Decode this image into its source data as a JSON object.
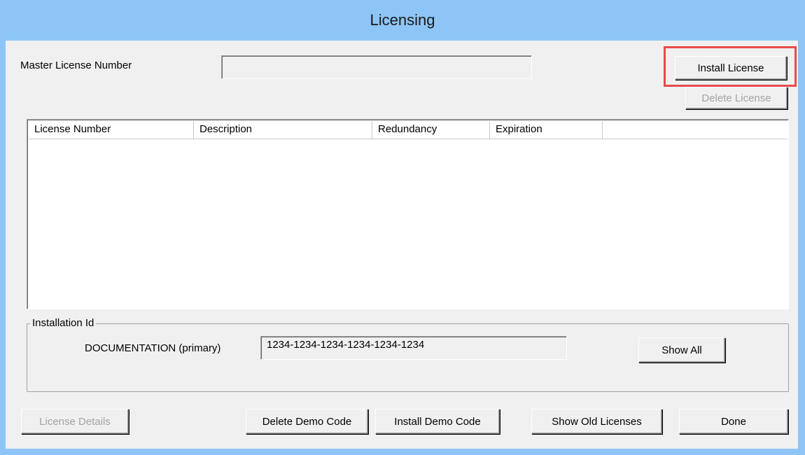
{
  "window": {
    "title": "Licensing"
  },
  "master_license": {
    "label": "Master License Number",
    "value": ""
  },
  "buttons": {
    "install_license": "Install License",
    "delete_license": "Delete License",
    "show_all": "Show All",
    "license_details": "License Details",
    "delete_demo_code": "Delete Demo Code",
    "install_demo_code": "Install Demo Code",
    "show_old_licenses": "Show Old Licenses",
    "done": "Done"
  },
  "license_table": {
    "columns": [
      "License Number",
      "Description",
      "Redundancy",
      "Expiration"
    ],
    "rows": []
  },
  "installation": {
    "group_title": "Installation Id",
    "name_label": "DOCUMENTATION (primary)",
    "id_value": "1234-1234-1234-1234-1234-1234"
  },
  "highlight_color": "#e84a4a"
}
